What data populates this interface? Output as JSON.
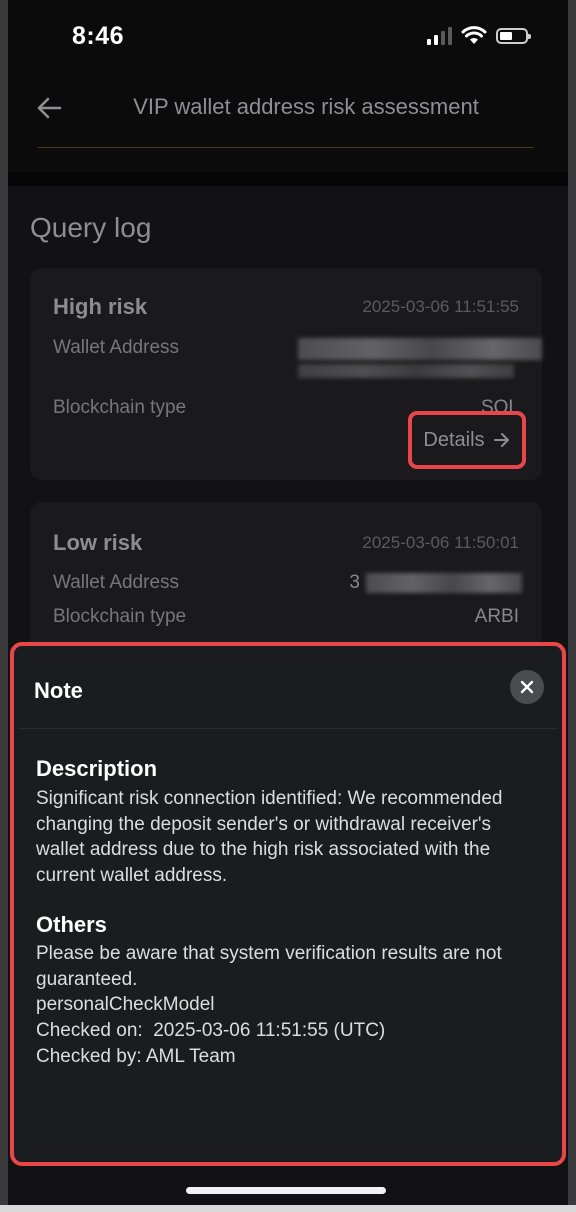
{
  "status_bar": {
    "time": "8:46"
  },
  "header": {
    "title": "VIP wallet address risk assessment"
  },
  "query_log": {
    "title": "Query log",
    "entries": [
      {
        "risk": "High risk",
        "timestamp": "2025-03-06 11:51:55",
        "wallet_label": "Wallet Address",
        "chain_label": "Blockchain type",
        "chain_value": "SOL",
        "details_label": "Details"
      },
      {
        "risk": "Low risk",
        "timestamp": "2025-03-06 11:50:01",
        "wallet_label": "Wallet Address",
        "wallet_prefix": "3",
        "chain_label": "Blockchain type",
        "chain_value": "ARBI"
      }
    ]
  },
  "note": {
    "title": "Note",
    "description_heading": "Description",
    "description_text": "Significant risk connection identified: We recommended changing the deposit sender's or withdrawal receiver's wallet address due to the high risk associated with the current wallet address.",
    "others_heading": "Others",
    "others_text": "Please be aware that system verification results are not guaranteed.",
    "model": "personalCheckModel",
    "checked_on": "Checked on:  2025-03-06 11:51:55 (UTC)",
    "checked_by": "Checked by: AML Team"
  },
  "colors": {
    "highlight": "#e8474a",
    "modal_bg": "#1b1c1f",
    "page_bg": "#121214"
  },
  "icons": [
    "back-arrow-icon",
    "arrow-right-icon",
    "close-icon",
    "signal-icon",
    "wifi-icon",
    "battery-icon"
  ]
}
